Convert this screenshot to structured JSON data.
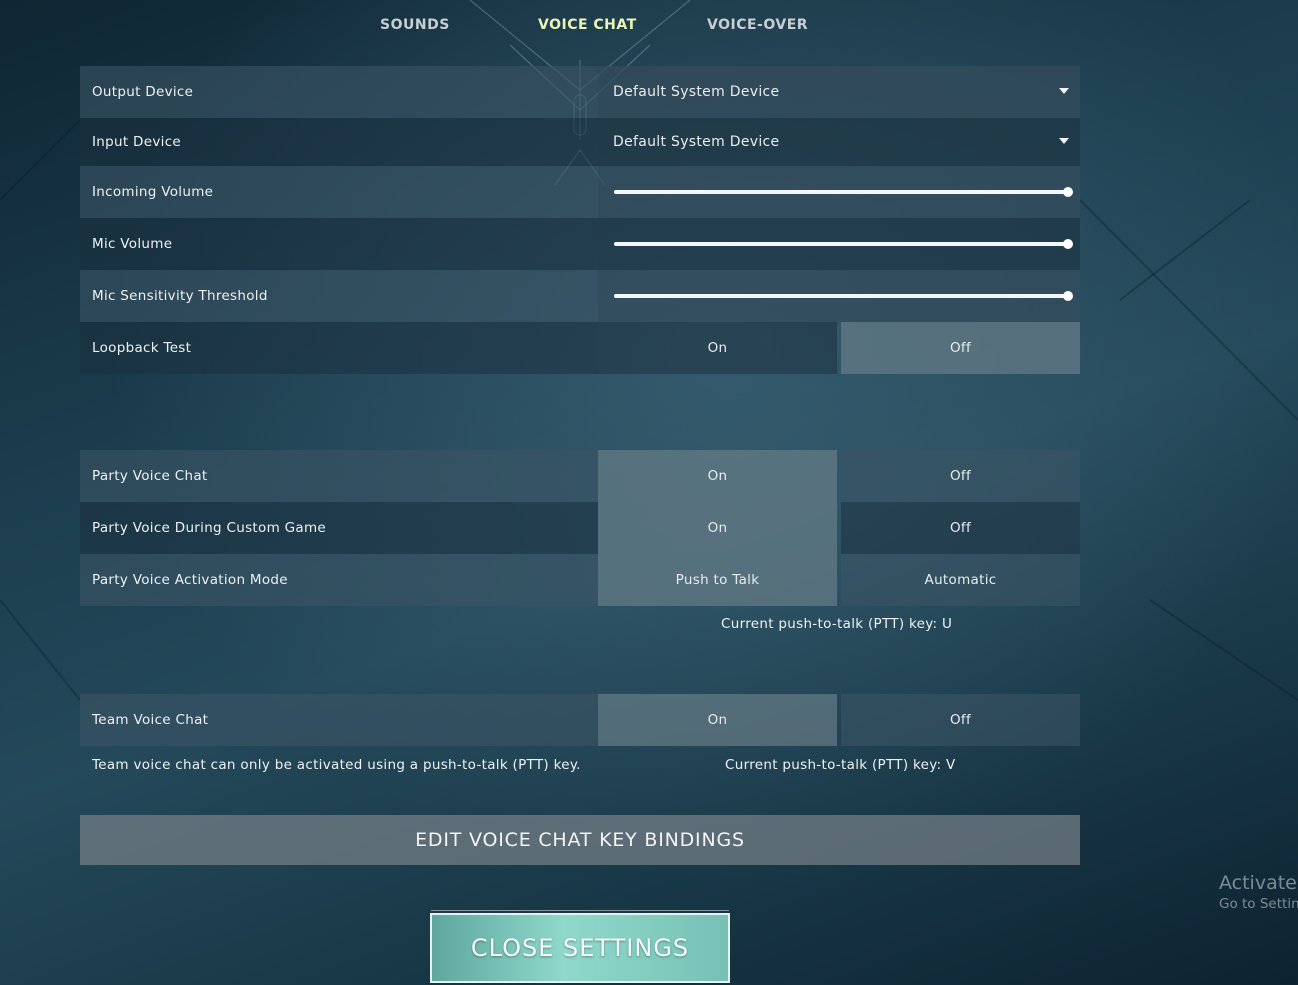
{
  "tabs": [
    {
      "label": "SOUNDS",
      "active": false
    },
    {
      "label": "VOICE CHAT",
      "active": true
    },
    {
      "label": "VOICE-OVER",
      "active": false
    }
  ],
  "devices": {
    "output": {
      "label": "Output Device",
      "value": "Default System Device"
    },
    "input": {
      "label": "Input Device",
      "value": "Default System Device"
    }
  },
  "volumes": {
    "incoming": {
      "label": "Incoming Volume",
      "level": 1.0
    },
    "mic": {
      "label": "Mic Volume",
      "level": 1.0
    },
    "sensitivity": {
      "label": "Mic Sensitivity Threshold",
      "level": 1.0
    }
  },
  "loopback": {
    "label": "Loopback Test",
    "on_label": "On",
    "off_label": "Off",
    "selected": "Off"
  },
  "party": {
    "voice_chat": {
      "label": "Party Voice Chat",
      "on_label": "On",
      "off_label": "Off",
      "selected": "On"
    },
    "custom_game": {
      "label": "Party Voice During Custom Game",
      "on_label": "On",
      "off_label": "Off",
      "selected": "On"
    },
    "activation": {
      "label": "Party Voice Activation Mode",
      "left_label": "Push to Talk",
      "right_label": "Automatic",
      "selected": "Push to Talk"
    },
    "ptt_note": "Current push-to-talk (PTT) key: U"
  },
  "team": {
    "voice_chat": {
      "label": "Team Voice Chat",
      "on_label": "On",
      "off_label": "Off",
      "selected": "On"
    },
    "info": "Team voice chat can only be activated using a push-to-talk (PTT) key.",
    "ptt_note": "Current push-to-talk (PTT) key: V"
  },
  "buttons": {
    "edit_bindings": "EDIT VOICE CHAT KEY BINDINGS",
    "close": "CLOSE SETTINGS"
  },
  "watermark": {
    "line1": "Activate W",
    "line2": "Go to Settin"
  },
  "icons": [
    "caret-down-icon"
  ],
  "colors": {
    "active_tab": "#e9f5b8",
    "close_button": "#8fd8cb"
  }
}
